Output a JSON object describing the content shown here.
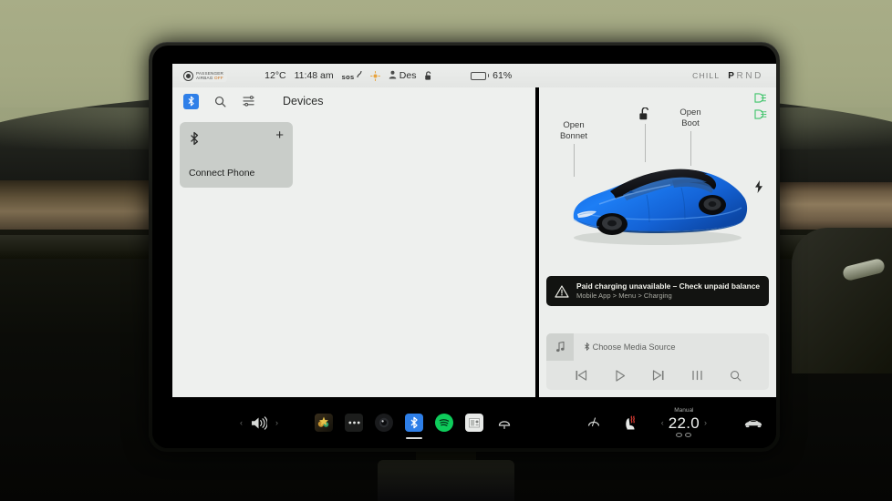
{
  "statusbar": {
    "airbag_line1": "PASSENGER",
    "airbag_line2": "AIRBAG",
    "airbag_off": "OFF",
    "temperature": "12°C",
    "time": "11:48 am",
    "sos_label": "sos",
    "profile_name": "Des",
    "battery_percent": "61%",
    "battery_level": 61,
    "drive_mode": "CHILL",
    "gear_p": "P",
    "gear_rnd": "RND"
  },
  "app_panel": {
    "title": "Devices",
    "bluetooth_icon": "bluetooth-icon",
    "search_icon": "search-icon",
    "filter_icon": "list-filter-icon",
    "card": {
      "label": "Connect Phone",
      "icon": "bluetooth-icon",
      "add_label": "+"
    }
  },
  "car_panel": {
    "open_bonnet": "Open\nBonnet",
    "open_bonnet_l1": "Open",
    "open_bonnet_l2": "Bonnet",
    "open_boot_l1": "Open",
    "open_boot_l2": "Boot",
    "lock_icon": "unlocked-padlock-icon",
    "charge_port_icon": "charge-bolt-icon",
    "headlight_icon": "headlight-low-beam-icon",
    "foglight_icon": "fog-light-icon",
    "car_color": "#1871e8",
    "roof_color": "#15161a"
  },
  "alert": {
    "icon": "warning-triangle-icon",
    "title": "Paid charging unavailable – Check unpaid balance",
    "subtitle": "Mobile App > Menu > Charging"
  },
  "media": {
    "art_icon": "music-note-icon",
    "source_label": "Choose Media Source",
    "controls": [
      {
        "name": "previous-track-button",
        "glyph": "skip-back-icon"
      },
      {
        "name": "play-button",
        "glyph": "play-icon"
      },
      {
        "name": "next-track-button",
        "glyph": "skip-forward-icon"
      },
      {
        "name": "equalizer-button",
        "glyph": "equalizer-icon"
      },
      {
        "name": "media-search-button",
        "glyph": "search-icon"
      }
    ]
  },
  "dock": {
    "volume_icon": "volume-speaker-icon",
    "prev_chevron": "‹",
    "next_chevron": "›",
    "apps": [
      {
        "name": "dock-app-toybox",
        "label": "Toybox",
        "active": false
      },
      {
        "name": "dock-app-more",
        "label": "More",
        "active": false
      },
      {
        "name": "dock-app-dashcam",
        "label": "Dashcam",
        "active": false
      },
      {
        "name": "dock-app-bluetooth",
        "label": "Bluetooth",
        "active": true
      },
      {
        "name": "dock-app-spotify",
        "label": "Spotify",
        "active": false
      },
      {
        "name": "dock-app-tunein",
        "label": "TuneIn",
        "active": false
      },
      {
        "name": "dock-app-defrost",
        "label": "Defrost",
        "active": false
      }
    ],
    "seat_heater_icon": "heated-seat-icon",
    "climate_mode": "Manual",
    "temperature_value": "22.0",
    "temp_down": "‹",
    "temp_up": "›",
    "car_controls_icon": "car-front-icon"
  }
}
